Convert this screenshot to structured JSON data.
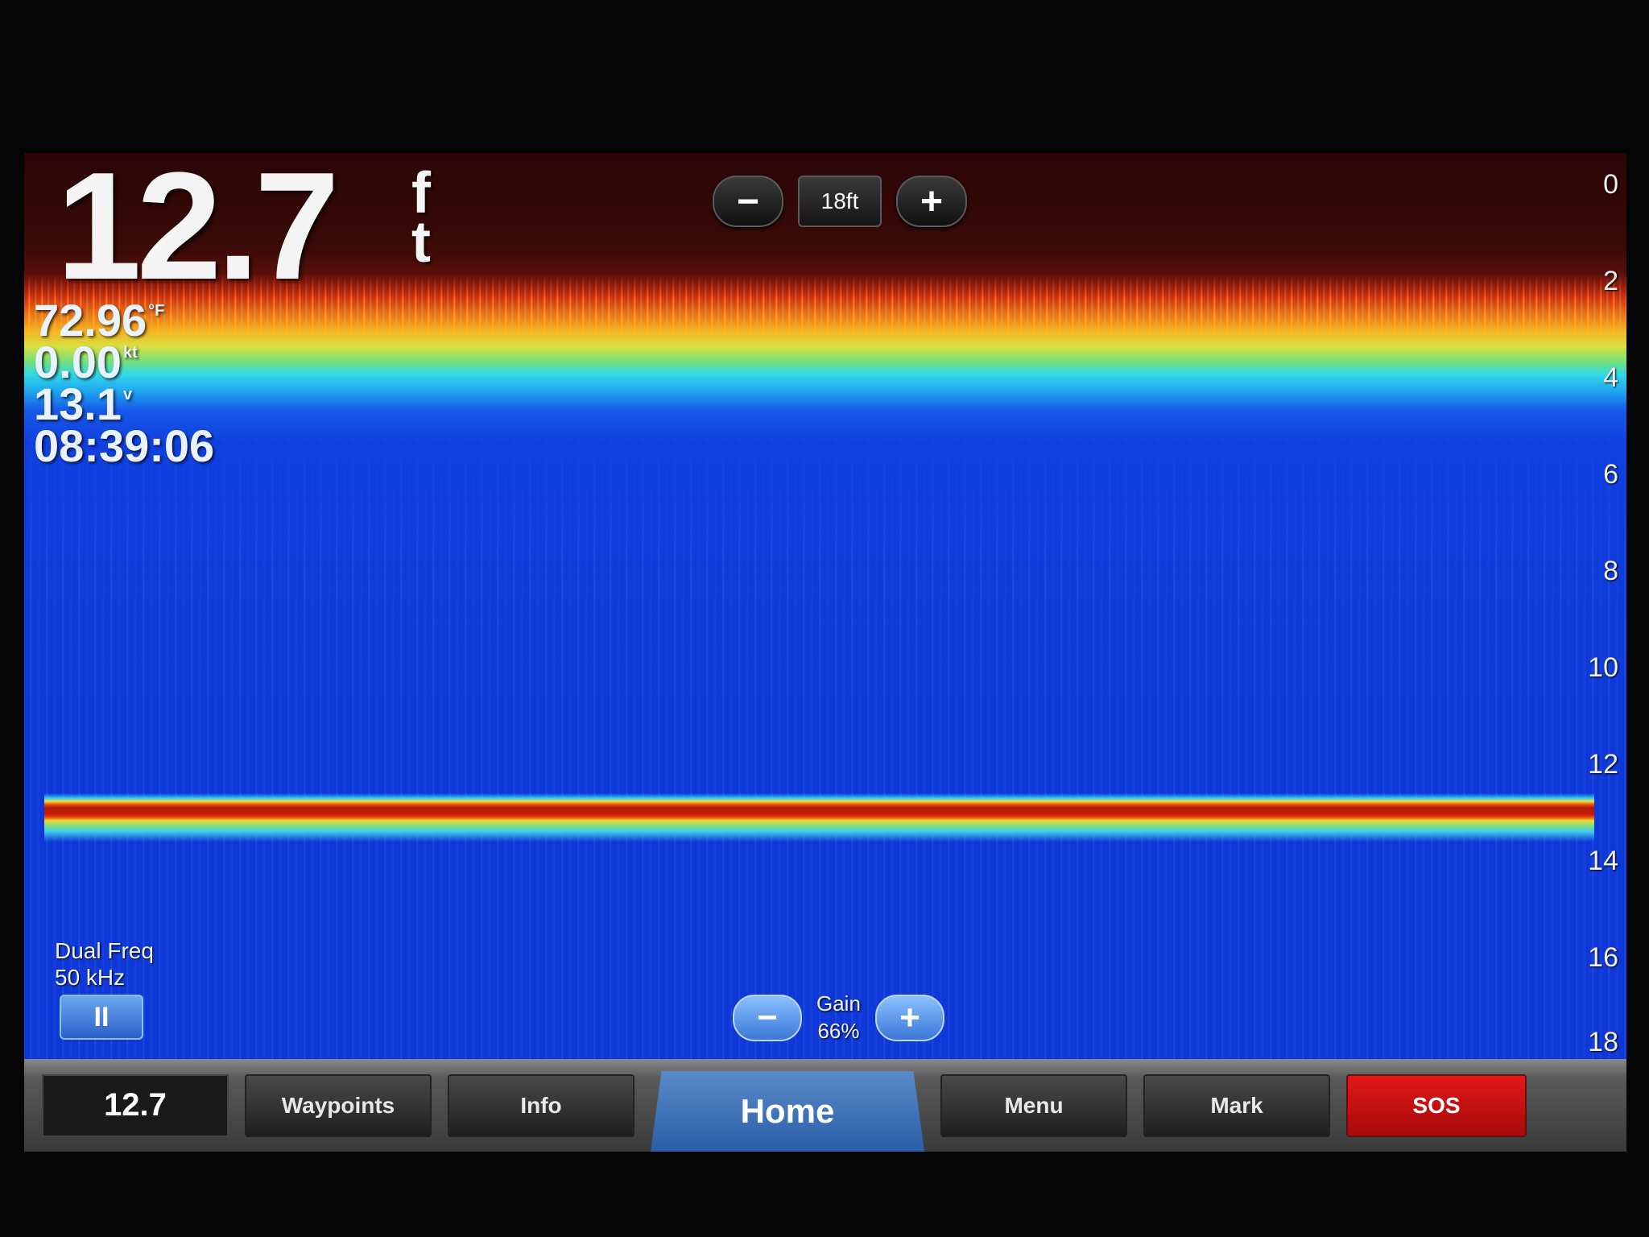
{
  "depth": {
    "value": "12.7",
    "unit_top": "f",
    "unit_bottom": "t"
  },
  "readouts": {
    "water_temp": "72.96",
    "water_temp_unit": "°F",
    "speed": "0.00",
    "speed_unit": "kt",
    "voltage": "13.1",
    "voltage_unit": "v",
    "time": "08:39:06"
  },
  "range": {
    "minus": "−",
    "value": "18ft",
    "plus": "+"
  },
  "depth_scale": [
    "0",
    "2",
    "4",
    "6",
    "8",
    "10",
    "12",
    "14",
    "16",
    "18"
  ],
  "frequency": {
    "mode": "Dual Freq",
    "value": "50 kHz",
    "pause_symbol": "II"
  },
  "gain": {
    "label": "Gain",
    "value": "66%",
    "minus": "−",
    "plus": "+"
  },
  "bottom_bar": {
    "depth_value": "12.7",
    "waypoints": "Waypoints",
    "info": "Info",
    "home": "Home",
    "menu": "Menu",
    "mark": "Mark",
    "sos": "SOS"
  },
  "colors": {
    "water": "#1038d8",
    "sos": "#e01818",
    "home_tab": "#2a5ea8"
  }
}
